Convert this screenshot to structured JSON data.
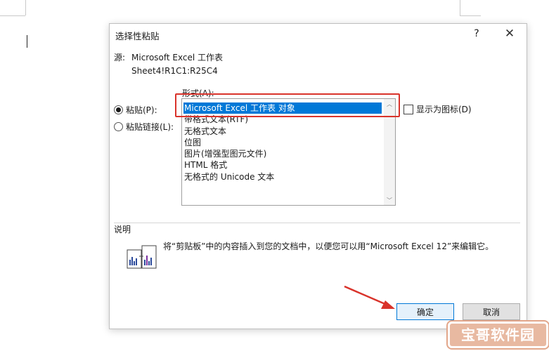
{
  "dialog": {
    "title": "选择性粘贴",
    "help_label": "?",
    "close_label": "✕"
  },
  "source": {
    "label": "源:",
    "name": "Microsoft Excel 工作表",
    "range": "Sheet4!R1C1:R25C4"
  },
  "as_label": "形式(A):",
  "options": {
    "paste": {
      "label": "粘贴(P):",
      "selected": true
    },
    "paste_link": {
      "label": "粘贴链接(L):",
      "selected": false
    }
  },
  "formats": [
    {
      "label": "Microsoft Excel 工作表 对象",
      "selected": true
    },
    {
      "label": "带格式文本(RTF)",
      "selected": false
    },
    {
      "label": "无格式文本",
      "selected": false
    },
    {
      "label": "位图",
      "selected": false
    },
    {
      "label": "图片(增强型图元文件)",
      "selected": false
    },
    {
      "label": "HTML 格式",
      "selected": false
    },
    {
      "label": "无格式的 Unicode 文本",
      "selected": false
    }
  ],
  "display_as_icon": {
    "label": "显示为图标(D)",
    "checked": false
  },
  "result": {
    "label": "说明",
    "text": "将“剪贴板”中的内容插入到您的文档中，以便您可以用“Microsoft Excel 12”来编辑它。"
  },
  "buttons": {
    "ok": "确定",
    "cancel": "取消"
  },
  "watermark": "宝哥软件园",
  "colors": {
    "accent": "#0078d7",
    "annotation_red": "#d9332b",
    "watermark_bg": "#e8b9a1"
  }
}
